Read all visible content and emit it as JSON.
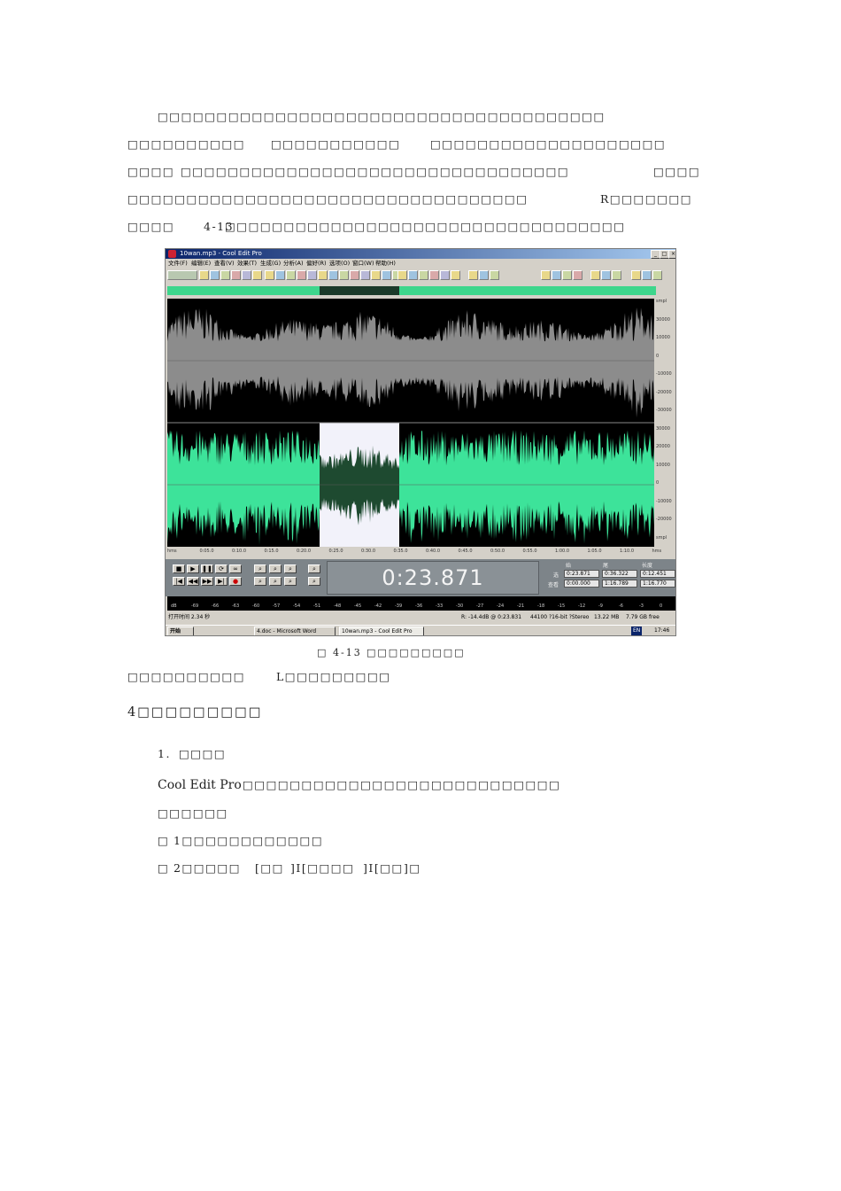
{
  "paragraph": {
    "line1": "□□□□□□□□□□□□□□□□□□□□□□□□□□□□□□□□□□□□□□",
    "line2": [
      "□□□□□□□□□□",
      "□□□□□□□□□□□",
      "□□□□□□□□□□□□□□□□□□□□"
    ],
    "line3": [
      "□□□□",
      "□□□□□□□□□□□□□□□□□□□□□□□□□□□□□□□□□",
      "□□□□"
    ],
    "line4": [
      "□□□□□□□□□□□□□□□□□□□□□□□□□□□□□□□□□□",
      "R□□□□□□□"
    ],
    "line5": [
      "□□□□",
      "4-13",
      "□□□□□□□□□□□□□□□□□□□□□□□□□□□□□□□□□□"
    ]
  },
  "screenshot": {
    "window_title": "10wan.mp3 - Cool Edit Pro",
    "menu": [
      "文件(F)",
      "编辑(E)",
      "查看(V)",
      "效果(T)",
      "生成(G)",
      "分析(A)",
      "偏好(R)",
      "选项(O)",
      "窗口(W)",
      "帮助(H)"
    ],
    "time_display": "0:23.871",
    "sel_headers": [
      "始",
      "尾",
      "长度"
    ],
    "sel_labels": [
      "选",
      "查看"
    ],
    "sel_values": [
      "0:23.871",
      "0:36.322",
      "0:12.451",
      "0:00.000",
      "1:16.789",
      "1:16.770"
    ],
    "ruler_labels": [
      "smpl",
      "30000",
      "10000",
      "0",
      "-10000",
      "-20000",
      "-30000",
      "30000",
      "20000",
      "10000",
      "0",
      "-10000",
      "-20000",
      "smpl"
    ],
    "timeline_labels": [
      "hms",
      "0:05.0",
      "0:10.0",
      "0:15.0",
      "0:20.0",
      "0:25.0",
      "0:30.0",
      "0:35.0",
      "0:40.0",
      "0:45.0",
      "0:50.0",
      "0:55.0",
      "1:00.0",
      "1:05.0",
      "1:10.0",
      "hms"
    ],
    "level_labels": [
      "dB",
      "-69",
      "-66",
      "-63",
      "-60",
      "-57",
      "-54",
      "-51",
      "-48",
      "-45",
      "-42",
      "-39",
      "-36",
      "-33",
      "-30",
      "-27",
      "-24",
      "-21",
      "-18",
      "-15",
      "-12",
      "-9",
      "-6",
      "-3",
      "0"
    ],
    "status": {
      "open_time": "打开时间 2.34 秒",
      "level": "R: -14.4dB @ 0:23.831",
      "format": "44100 ?16-bit ?Stereo",
      "size": "13.22 MB",
      "free": "7.79 GB free"
    },
    "taskbar": {
      "start": "开始",
      "task1": "4.doc - Microsoft Word",
      "task2": "10wan.mp3 - Cool Edit Pro",
      "lang": "EN",
      "clock": "17:46"
    },
    "colors": {
      "top_wave": "#8c8c8c",
      "bottom_wave": "#3de39a",
      "selection_bg": "#f2f2fa",
      "selection_wave": "#1e4a30"
    }
  },
  "figure_caption": [
    "□",
    "4-13",
    "□□□□□□□□□"
  ],
  "after_figure": [
    "□□□□□□□□□□",
    "L□□□□□□□□□"
  ],
  "section_heading": "4□□□□□□□□□",
  "subheading": [
    "1.",
    "□□□□"
  ],
  "body_line1": [
    "Cool Edit Pro",
    "□□□□□□□□□□□□□□□□□□□□□□□□□□□"
  ],
  "body_line2": "□□□□□□",
  "step1": [
    "□",
    "1□□□□□□□□□□□□"
  ],
  "step2": [
    "□",
    "2□□□□□",
    "[□□",
    "]I[□□□□",
    "]I[□□",
    "]□"
  ]
}
